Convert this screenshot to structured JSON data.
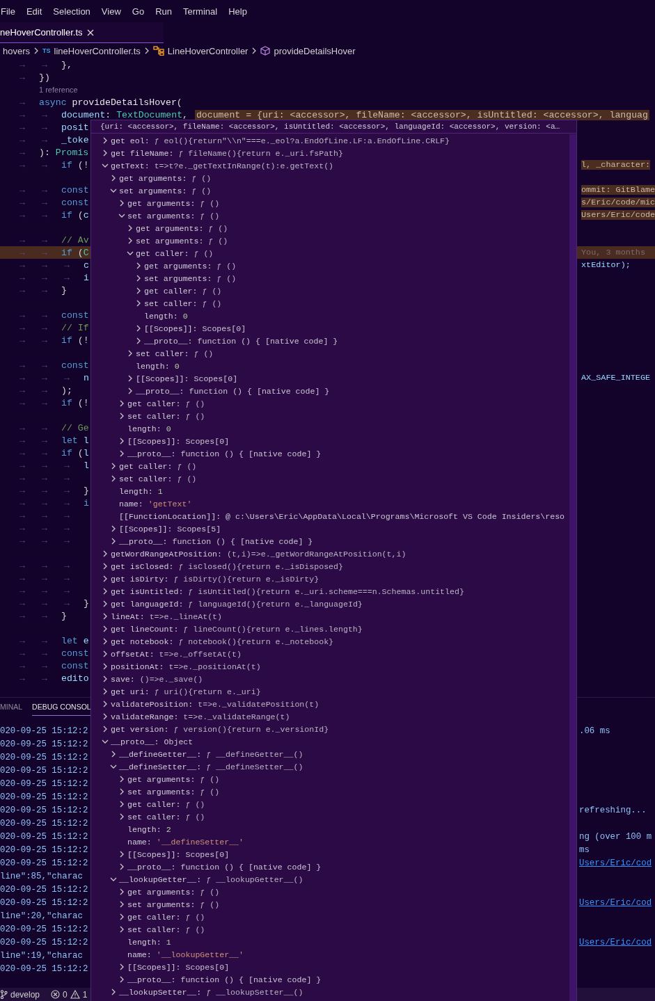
{
  "menu": [
    "File",
    "Edit",
    "Selection",
    "View",
    "Go",
    "Run",
    "Terminal",
    "Help"
  ],
  "editor_tab": {
    "label": "neHoverController.ts"
  },
  "breadcrumb": [
    {
      "kind": "folder",
      "text": "hovers"
    },
    {
      "kind": "file",
      "badge": "TS",
      "text": "lineHoverController.ts"
    },
    {
      "kind": "class",
      "text": "LineHoverController"
    },
    {
      "kind": "method",
      "text": "provideDetailsHover"
    }
  ],
  "editor": {
    "lines": [
      {
        "kind": "code",
        "highlighted": false,
        "tokens": [
          {
            "kind": "ws",
            "text": "→→"
          },
          {
            "kind": "punct",
            "text": "},"
          }
        ]
      },
      {
        "kind": "code",
        "highlighted": false,
        "tokens": [
          {
            "kind": "ws",
            "text": "→"
          },
          {
            "kind": "punct",
            "text": "})"
          }
        ]
      },
      {
        "kind": "codelens",
        "highlighted": false,
        "text": "1 reference"
      },
      {
        "kind": "code",
        "highlighted": false,
        "tokens": [
          {
            "kind": "ws",
            "text": "→"
          },
          {
            "kind": "kw",
            "text": "async "
          },
          {
            "kind": "fn",
            "text": "provideDetailsHover"
          },
          {
            "kind": "punct",
            "text": "("
          }
        ]
      },
      {
        "kind": "code",
        "highlighted": false,
        "tokens": [
          {
            "kind": "ws",
            "text": "→→"
          },
          {
            "kind": "param",
            "text": "document"
          },
          {
            "kind": "punct",
            "text": ": "
          },
          {
            "kind": "type",
            "text": "TextDocument"
          },
          {
            "kind": "punct",
            "text": ", "
          },
          {
            "kind": "inlay",
            "text": "document = {uri: <accessor>, fileName: <accessor>, isUntitled: <accessor>, languag"
          }
        ]
      },
      {
        "kind": "code",
        "highlighted": false,
        "tokens": [
          {
            "kind": "ws",
            "text": "→→"
          },
          {
            "kind": "param",
            "text": "posit"
          }
        ]
      },
      {
        "kind": "code",
        "highlighted": false,
        "tokens": [
          {
            "kind": "ws",
            "text": "→→"
          },
          {
            "kind": "param",
            "text": "_toke"
          }
        ]
      },
      {
        "kind": "code",
        "highlighted": false,
        "tokens": [
          {
            "kind": "ws",
            "text": "→"
          },
          {
            "kind": "punct",
            "text": "): "
          },
          {
            "kind": "type",
            "text": "Promis"
          }
        ]
      },
      {
        "kind": "code",
        "highlighted": false,
        "tokens": [
          {
            "kind": "ws",
            "text": "→→"
          },
          {
            "kind": "kw",
            "text": "if"
          },
          {
            "kind": "punct",
            "text": " (!"
          }
        ],
        "right": {
          "kind": "inlay",
          "text": "l, _character:"
        }
      },
      {
        "kind": "code",
        "highlighted": false
      },
      {
        "kind": "code",
        "highlighted": false,
        "tokens": [
          {
            "kind": "ws",
            "text": "→→"
          },
          {
            "kind": "kw",
            "text": "const"
          }
        ],
        "right": {
          "kind": "inlay",
          "text": "ommit: GitBlame"
        }
      },
      {
        "kind": "code",
        "highlighted": false,
        "tokens": [
          {
            "kind": "ws",
            "text": "→→"
          },
          {
            "kind": "kw",
            "text": "const"
          }
        ],
        "right": {
          "kind": "inlay",
          "text": "s/Eric/code/mic"
        }
      },
      {
        "kind": "code",
        "highlighted": false,
        "tokens": [
          {
            "kind": "ws",
            "text": "→→"
          },
          {
            "kind": "kw",
            "text": "if"
          },
          {
            "kind": "punct",
            "text": " ("
          },
          {
            "kind": "param",
            "text": "c"
          }
        ],
        "right": {
          "kind": "inlay",
          "text": "Users/Eric/code"
        }
      },
      {
        "kind": "code",
        "highlighted": false
      },
      {
        "kind": "code",
        "highlighted": false,
        "tokens": [
          {
            "kind": "ws",
            "text": "→→"
          },
          {
            "kind": "comment",
            "text": "// Av"
          }
        ]
      },
      {
        "kind": "code",
        "highlighted": true,
        "tokens": [
          {
            "kind": "ws",
            "text": "→→"
          },
          {
            "kind": "kw",
            "text": "if"
          },
          {
            "kind": "punct",
            "text": " ("
          },
          {
            "kind": "type",
            "text": "C"
          }
        ],
        "right": {
          "kind": "blame",
          "text": "You, 3 months"
        }
      },
      {
        "kind": "code",
        "highlighted": false,
        "tokens": [
          {
            "kind": "ws",
            "text": "→→→"
          },
          {
            "kind": "param",
            "text": "c"
          }
        ],
        "right": {
          "kind": "code",
          "text": "xtEditor);"
        }
      },
      {
        "kind": "code",
        "highlighted": false,
        "tokens": [
          {
            "kind": "ws",
            "text": "→→→"
          },
          {
            "kind": "param",
            "text": "i"
          }
        ]
      },
      {
        "kind": "code",
        "highlighted": false,
        "tokens": [
          {
            "kind": "ws",
            "text": "→→"
          },
          {
            "kind": "punct",
            "text": "}"
          }
        ]
      },
      {
        "kind": "code",
        "highlighted": false
      },
      {
        "kind": "code",
        "highlighted": false,
        "tokens": [
          {
            "kind": "ws",
            "text": "→→"
          },
          {
            "kind": "kw",
            "text": "const"
          }
        ]
      },
      {
        "kind": "code",
        "highlighted": false,
        "tokens": [
          {
            "kind": "ws",
            "text": "→→"
          },
          {
            "kind": "comment",
            "text": "// If"
          }
        ]
      },
      {
        "kind": "code",
        "highlighted": false,
        "tokens": [
          {
            "kind": "ws",
            "text": "→→"
          },
          {
            "kind": "kw",
            "text": "if"
          },
          {
            "kind": "punct",
            "text": " (!"
          }
        ]
      },
      {
        "kind": "code",
        "highlighted": false
      },
      {
        "kind": "code",
        "highlighted": false,
        "tokens": [
          {
            "kind": "ws",
            "text": "→→"
          },
          {
            "kind": "kw",
            "text": "const"
          }
        ]
      },
      {
        "kind": "code",
        "highlighted": false,
        "tokens": [
          {
            "kind": "ws",
            "text": "→→→"
          },
          {
            "kind": "param",
            "text": "n"
          }
        ],
        "right": {
          "kind": "code",
          "text": "AX_SAFE_INTEGE"
        }
      },
      {
        "kind": "code",
        "highlighted": false,
        "tokens": [
          {
            "kind": "ws",
            "text": "→→"
          },
          {
            "kind": "punct",
            "text": ");"
          }
        ]
      },
      {
        "kind": "code",
        "highlighted": false,
        "tokens": [
          {
            "kind": "ws",
            "text": "→→"
          },
          {
            "kind": "kw",
            "text": "if"
          },
          {
            "kind": "punct",
            "text": " (!"
          }
        ]
      },
      {
        "kind": "code",
        "highlighted": false
      },
      {
        "kind": "code",
        "highlighted": false,
        "tokens": [
          {
            "kind": "ws",
            "text": "→→"
          },
          {
            "kind": "comment",
            "text": "// Ge"
          }
        ]
      },
      {
        "kind": "code",
        "highlighted": false,
        "tokens": [
          {
            "kind": "ws",
            "text": "→→"
          },
          {
            "kind": "kw",
            "text": "let "
          },
          {
            "kind": "param",
            "text": "l"
          }
        ]
      },
      {
        "kind": "code",
        "highlighted": false,
        "tokens": [
          {
            "kind": "ws",
            "text": "→→"
          },
          {
            "kind": "kw",
            "text": "if"
          },
          {
            "kind": "punct",
            "text": " ("
          },
          {
            "kind": "param",
            "text": "l"
          }
        ]
      },
      {
        "kind": "code",
        "highlighted": false,
        "tokens": [
          {
            "kind": "ws",
            "text": "→→→"
          },
          {
            "kind": "param",
            "text": "l"
          }
        ]
      },
      {
        "kind": "code",
        "highlighted": false,
        "tokens": [
          {
            "kind": "ws",
            "text": "→→→"
          }
        ]
      },
      {
        "kind": "code",
        "highlighted": false,
        "tokens": [
          {
            "kind": "ws",
            "text": "→→→"
          },
          {
            "kind": "punct",
            "text": "}"
          }
        ]
      },
      {
        "kind": "code",
        "highlighted": false,
        "tokens": [
          {
            "kind": "ws",
            "text": "→→→"
          },
          {
            "kind": "kw",
            "text": "i"
          }
        ]
      },
      {
        "kind": "code",
        "highlighted": false,
        "tokens": [
          {
            "kind": "ws",
            "text": "→→→"
          }
        ]
      },
      {
        "kind": "code",
        "highlighted": false,
        "tokens": [
          {
            "kind": "ws",
            "text": "→→→"
          }
        ]
      },
      {
        "kind": "code",
        "highlighted": false,
        "tokens": [
          {
            "kind": "ws",
            "text": "→→→"
          }
        ]
      },
      {
        "kind": "code",
        "highlighted": false
      },
      {
        "kind": "code",
        "highlighted": false,
        "tokens": [
          {
            "kind": "ws",
            "text": "→→→"
          }
        ]
      },
      {
        "kind": "code",
        "highlighted": false,
        "tokens": [
          {
            "kind": "ws",
            "text": "→→→"
          }
        ]
      },
      {
        "kind": "code",
        "highlighted": false,
        "tokens": [
          {
            "kind": "ws",
            "text": "→→→"
          }
        ]
      },
      {
        "kind": "code",
        "highlighted": false,
        "tokens": [
          {
            "kind": "ws",
            "text": "→→→"
          },
          {
            "kind": "punct",
            "text": "}"
          }
        ]
      },
      {
        "kind": "code",
        "highlighted": false,
        "tokens": [
          {
            "kind": "ws",
            "text": "→→"
          },
          {
            "kind": "punct",
            "text": "}"
          }
        ]
      },
      {
        "kind": "code",
        "highlighted": false
      },
      {
        "kind": "code",
        "highlighted": false,
        "tokens": [
          {
            "kind": "ws",
            "text": "→→"
          },
          {
            "kind": "kw",
            "text": "let "
          },
          {
            "kind": "param",
            "text": "e"
          }
        ]
      },
      {
        "kind": "code",
        "highlighted": false,
        "tokens": [
          {
            "kind": "ws",
            "text": "→→"
          },
          {
            "kind": "kw",
            "text": "const"
          }
        ]
      },
      {
        "kind": "code",
        "highlighted": false,
        "tokens": [
          {
            "kind": "ws",
            "text": "→→"
          },
          {
            "kind": "kw",
            "text": "const"
          }
        ]
      },
      {
        "kind": "code",
        "highlighted": false,
        "tokens": [
          {
            "kind": "ws",
            "text": "→→"
          },
          {
            "kind": "param",
            "text": "edito"
          }
        ]
      }
    ]
  },
  "hover": {
    "header": "{uri: <accessor>, fileName: <accessor>, isUntitled: <accessor>, languageId: <accessor>, version: <a…",
    "tree": [
      {
        "kind": "group",
        "name": "get eol:",
        "value": {
          "kind": "function",
          "text": "ƒ eol(){return\"\\\\n\"===e._eol?a.EndOfLine.LF:a.EndOfLine.CRLF}"
        },
        "expanded": false
      },
      {
        "kind": "group",
        "name": "get fileName:",
        "value": {
          "kind": "function",
          "text": "ƒ fileName(){return e._uri.fsPath}"
        },
        "expanded": false
      },
      {
        "kind": "group",
        "name": "getText:",
        "value": {
          "kind": "function",
          "text": "t=>t?e._getTextInRange(t):e.getText()"
        },
        "expanded": true,
        "children": [
          {
            "kind": "group",
            "name": "get arguments:",
            "value": {
              "kind": "function",
              "text": "ƒ ()"
            },
            "expanded": false
          },
          {
            "kind": "group",
            "name": "set arguments:",
            "value": {
              "kind": "function",
              "text": "ƒ ()"
            },
            "expanded": true,
            "children": [
              {
                "kind": "group",
                "name": "get arguments:",
                "value": {
                  "kind": "function",
                  "text": "ƒ ()"
                },
                "expanded": false
              },
              {
                "kind": "group",
                "name": "set arguments:",
                "value": {
                  "kind": "function",
                  "text": "ƒ ()"
                },
                "expanded": true,
                "children": [
                  {
                    "kind": "group",
                    "name": "get arguments:",
                    "value": {
                      "kind": "function",
                      "text": "ƒ ()"
                    },
                    "expanded": false
                  },
                  {
                    "kind": "group",
                    "name": "set arguments:",
                    "value": {
                      "kind": "function",
                      "text": "ƒ ()"
                    },
                    "expanded": false
                  },
                  {
                    "kind": "group",
                    "name": "get caller:",
                    "value": {
                      "kind": "function",
                      "text": "ƒ ()"
                    },
                    "expanded": true,
                    "children": [
                      {
                        "kind": "group",
                        "name": "get arguments:",
                        "value": {
                          "kind": "function",
                          "text": "ƒ ()"
                        },
                        "expanded": false
                      },
                      {
                        "kind": "group",
                        "name": "set arguments:",
                        "value": {
                          "kind": "function",
                          "text": "ƒ ()"
                        },
                        "expanded": false
                      },
                      {
                        "kind": "group",
                        "name": "get caller:",
                        "value": {
                          "kind": "function",
                          "text": "ƒ ()"
                        },
                        "expanded": false
                      },
                      {
                        "kind": "group",
                        "name": "set caller:",
                        "value": {
                          "kind": "function",
                          "text": "ƒ ()"
                        },
                        "expanded": false
                      },
                      {
                        "kind": "leaf",
                        "name": "length:",
                        "value": {
                          "kind": "number",
                          "text": "0"
                        }
                      },
                      {
                        "kind": "group",
                        "name": "[[Scopes]]:",
                        "value": {
                          "kind": "object",
                          "text": "Scopes[0]"
                        },
                        "expanded": false
                      },
                      {
                        "kind": "group",
                        "name": "__proto__:",
                        "value": {
                          "kind": "object",
                          "text": "function () { [native code] }"
                        },
                        "expanded": false
                      }
                    ]
                  },
                  {
                    "kind": "group",
                    "name": "set caller:",
                    "value": {
                      "kind": "function",
                      "text": "ƒ ()"
                    },
                    "expanded": false
                  },
                  {
                    "kind": "leaf",
                    "name": "length:",
                    "value": {
                      "kind": "number",
                      "text": "0"
                    }
                  },
                  {
                    "kind": "group",
                    "name": "[[Scopes]]:",
                    "value": {
                      "kind": "object",
                      "text": "Scopes[0]"
                    },
                    "expanded": false
                  },
                  {
                    "kind": "group",
                    "name": "__proto__:",
                    "value": {
                      "kind": "object",
                      "text": "function () { [native code] }"
                    },
                    "expanded": false
                  }
                ]
              },
              {
                "kind": "group",
                "name": "get caller:",
                "value": {
                  "kind": "function",
                  "text": "ƒ ()"
                },
                "expanded": false
              },
              {
                "kind": "group",
                "name": "set caller:",
                "value": {
                  "kind": "function",
                  "text": "ƒ ()"
                },
                "expanded": false
              },
              {
                "kind": "leaf",
                "name": "length:",
                "value": {
                  "kind": "number",
                  "text": "0"
                }
              },
              {
                "kind": "group",
                "name": "[[Scopes]]:",
                "value": {
                  "kind": "object",
                  "text": "Scopes[0]"
                },
                "expanded": false
              },
              {
                "kind": "group",
                "name": "__proto__:",
                "value": {
                  "kind": "object",
                  "text": "function () { [native code] }"
                },
                "expanded": false
              }
            ]
          },
          {
            "kind": "group",
            "name": "get caller:",
            "value": {
              "kind": "function",
              "text": "ƒ ()"
            },
            "expanded": false
          },
          {
            "kind": "group",
            "name": "set caller:",
            "value": {
              "kind": "function",
              "text": "ƒ ()"
            },
            "expanded": false
          },
          {
            "kind": "leaf",
            "name": "length:",
            "value": {
              "kind": "number",
              "text": "1"
            }
          },
          {
            "kind": "leaf",
            "name": "name:",
            "value": {
              "kind": "string",
              "text": "'getText'"
            }
          },
          {
            "kind": "leaf",
            "name": "[[FunctionLocation]]:",
            "value": {
              "kind": "object",
              "text": "@ c:\\Users\\Eric\\AppData\\Local\\Programs\\Microsoft VS Code Insiders\\reso"
            }
          },
          {
            "kind": "group",
            "name": "[[Scopes]]:",
            "value": {
              "kind": "object",
              "text": "Scopes[5]"
            },
            "expanded": false
          },
          {
            "kind": "group",
            "name": "__proto__:",
            "value": {
              "kind": "object",
              "text": "function () { [native code] }"
            },
            "expanded": false
          }
        ]
      },
      {
        "kind": "group",
        "name": "getWordRangeAtPosition:",
        "value": {
          "kind": "function",
          "text": "(t,i)=>e._getWordRangeAtPosition(t,i)"
        },
        "expanded": false
      },
      {
        "kind": "group",
        "name": "get isClosed:",
        "value": {
          "kind": "function",
          "text": "ƒ isClosed(){return e._isDisposed}"
        },
        "expanded": false
      },
      {
        "kind": "group",
        "name": "get isDirty:",
        "value": {
          "kind": "function",
          "text": "ƒ isDirty(){return e._isDirty}"
        },
        "expanded": false
      },
      {
        "kind": "group",
        "name": "get isUntitled:",
        "value": {
          "kind": "function",
          "text": "ƒ isUntitled(){return e._uri.scheme===n.Schemas.untitled}"
        },
        "expanded": false
      },
      {
        "kind": "group",
        "name": "get languageId:",
        "value": {
          "kind": "function",
          "text": "ƒ languageId(){return e._languageId}"
        },
        "expanded": false
      },
      {
        "kind": "group",
        "name": "lineAt:",
        "value": {
          "kind": "function",
          "text": "t=>e._lineAt(t)"
        },
        "expanded": false
      },
      {
        "kind": "group",
        "name": "get lineCount:",
        "value": {
          "kind": "function",
          "text": "ƒ lineCount(){return e._lines.length}"
        },
        "expanded": false
      },
      {
        "kind": "group",
        "name": "get notebook:",
        "value": {
          "kind": "function",
          "text": "ƒ notebook(){return e._notebook}"
        },
        "expanded": false
      },
      {
        "kind": "group",
        "name": "offsetAt:",
        "value": {
          "kind": "function",
          "text": "t=>e._offsetAt(t)"
        },
        "expanded": false
      },
      {
        "kind": "group",
        "name": "positionAt:",
        "value": {
          "kind": "function",
          "text": "t=>e._positionAt(t)"
        },
        "expanded": false
      },
      {
        "kind": "group",
        "name": "save:",
        "value": {
          "kind": "function",
          "text": "()=>e._save()"
        },
        "expanded": false
      },
      {
        "kind": "group",
        "name": "get uri:",
        "value": {
          "kind": "function",
          "text": "ƒ uri(){return e._uri}"
        },
        "expanded": false
      },
      {
        "kind": "group",
        "name": "validatePosition:",
        "value": {
          "kind": "function",
          "text": "t=>e._validatePosition(t)"
        },
        "expanded": false
      },
      {
        "kind": "group",
        "name": "validateRange:",
        "value": {
          "kind": "function",
          "text": "t=>e._validateRange(t)"
        },
        "expanded": false
      },
      {
        "kind": "group",
        "name": "get version:",
        "value": {
          "kind": "function",
          "text": "ƒ version(){return e._versionId}"
        },
        "expanded": false
      },
      {
        "kind": "group",
        "name": "__proto__:",
        "value": {
          "kind": "object",
          "text": "Object"
        },
        "expanded": true,
        "children": [
          {
            "kind": "group",
            "name": "__defineGetter__:",
            "value": {
              "kind": "function",
              "text": "ƒ __defineGetter__()"
            },
            "expanded": false
          },
          {
            "kind": "group",
            "name": "__defineSetter__:",
            "value": {
              "kind": "function",
              "text": "ƒ __defineSetter__()"
            },
            "expanded": true,
            "children": [
              {
                "kind": "group",
                "name": "get arguments:",
                "value": {
                  "kind": "function",
                  "text": "ƒ ()"
                },
                "expanded": false
              },
              {
                "kind": "group",
                "name": "set arguments:",
                "value": {
                  "kind": "function",
                  "text": "ƒ ()"
                },
                "expanded": false
              },
              {
                "kind": "group",
                "name": "get caller:",
                "value": {
                  "kind": "function",
                  "text": "ƒ ()"
                },
                "expanded": false
              },
              {
                "kind": "group",
                "name": "set caller:",
                "value": {
                  "kind": "function",
                  "text": "ƒ ()"
                },
                "expanded": false
              },
              {
                "kind": "leaf",
                "name": "length:",
                "value": {
                  "kind": "number",
                  "text": "2"
                }
              },
              {
                "kind": "leaf",
                "name": "name:",
                "value": {
                  "kind": "string",
                  "text": "'__defineSetter__'"
                }
              },
              {
                "kind": "group",
                "name": "[[Scopes]]:",
                "value": {
                  "kind": "object",
                  "text": "Scopes[0]"
                },
                "expanded": false
              },
              {
                "kind": "group",
                "name": "__proto__:",
                "value": {
                  "kind": "object",
                  "text": "function () { [native code] }"
                },
                "expanded": false
              }
            ]
          },
          {
            "kind": "group",
            "name": "__lookupGetter__:",
            "value": {
              "kind": "function",
              "text": "ƒ __lookupGetter__()"
            },
            "expanded": true,
            "children": [
              {
                "kind": "group",
                "name": "get arguments:",
                "value": {
                  "kind": "function",
                  "text": "ƒ ()"
                },
                "expanded": false
              },
              {
                "kind": "group",
                "name": "set arguments:",
                "value": {
                  "kind": "function",
                  "text": "ƒ ()"
                },
                "expanded": false
              },
              {
                "kind": "group",
                "name": "get caller:",
                "value": {
                  "kind": "function",
                  "text": "ƒ ()"
                },
                "expanded": false
              },
              {
                "kind": "group",
                "name": "set caller:",
                "value": {
                  "kind": "function",
                  "text": "ƒ ()"
                },
                "expanded": false
              },
              {
                "kind": "leaf",
                "name": "length:",
                "value": {
                  "kind": "number",
                  "text": "1"
                }
              },
              {
                "kind": "leaf",
                "name": "name:",
                "value": {
                  "kind": "string",
                  "text": "'__lookupGetter__'"
                }
              },
              {
                "kind": "group",
                "name": "[[Scopes]]:",
                "value": {
                  "kind": "object",
                  "text": "Scopes[0]"
                },
                "expanded": false
              },
              {
                "kind": "group",
                "name": "__proto__:",
                "value": {
                  "kind": "object",
                  "text": "function () { [native code] }"
                },
                "expanded": false
              }
            ]
          },
          {
            "kind": "group",
            "name": "__lookupSetter__:",
            "value": {
              "kind": "function",
              "text": "ƒ __lookupSetter__()"
            },
            "expanded": false
          }
        ]
      }
    ]
  },
  "panel": {
    "tabs": [
      {
        "label": "MINAL",
        "selected": false
      },
      {
        "label": "DEBUG CONSOL",
        "selected": true
      }
    ],
    "rows": [
      {
        "text": "020-09-25 15:12:2",
        "right": {
          "kind": "text",
          "text": ".06 ms"
        }
      },
      {
        "text": "020-09-25 15:12:2"
      },
      {
        "text": "020-09-25 15:12:2"
      },
      {
        "text": "020-09-25 15:12:2"
      },
      {
        "text": "020-09-25 15:12:2"
      },
      {
        "text": "020-09-25 15:12:2"
      },
      {
        "text": "020-09-25 15:12:2",
        "right": {
          "kind": "text",
          "text": "refreshing..."
        }
      },
      {
        "text": "020-09-25 15:12:2"
      },
      {
        "text": "020-09-25 15:12:2",
        "right": {
          "kind": "text",
          "text": "ng (over 100 m"
        }
      },
      {
        "text": "020-09-25 15:12:2",
        "right": {
          "kind": "text",
          "text": "ms"
        }
      },
      {
        "text": "020-09-25 15:12:2",
        "right": {
          "kind": "link",
          "text": "Users/Eric/cod"
        }
      },
      {
        "text": "line\":85,\"charac"
      },
      {
        "text": "020-09-25 15:12:2"
      },
      {
        "text": "020-09-25 15:12:2",
        "right": {
          "kind": "link",
          "text": "Users/Eric/cod"
        }
      },
      {
        "text": "line\":20,\"charac"
      },
      {
        "text": "020-09-25 15:12:2"
      },
      {
        "text": "020-09-25 15:12:2",
        "right": {
          "kind": "link",
          "text": "Users/Eric/cod"
        }
      },
      {
        "text": "line\":19,\"charac"
      },
      {
        "text": "020-09-25 15:12:2"
      }
    ]
  },
  "status_bar": {
    "branch": "develop",
    "errors": "0",
    "warnings": "1"
  }
}
